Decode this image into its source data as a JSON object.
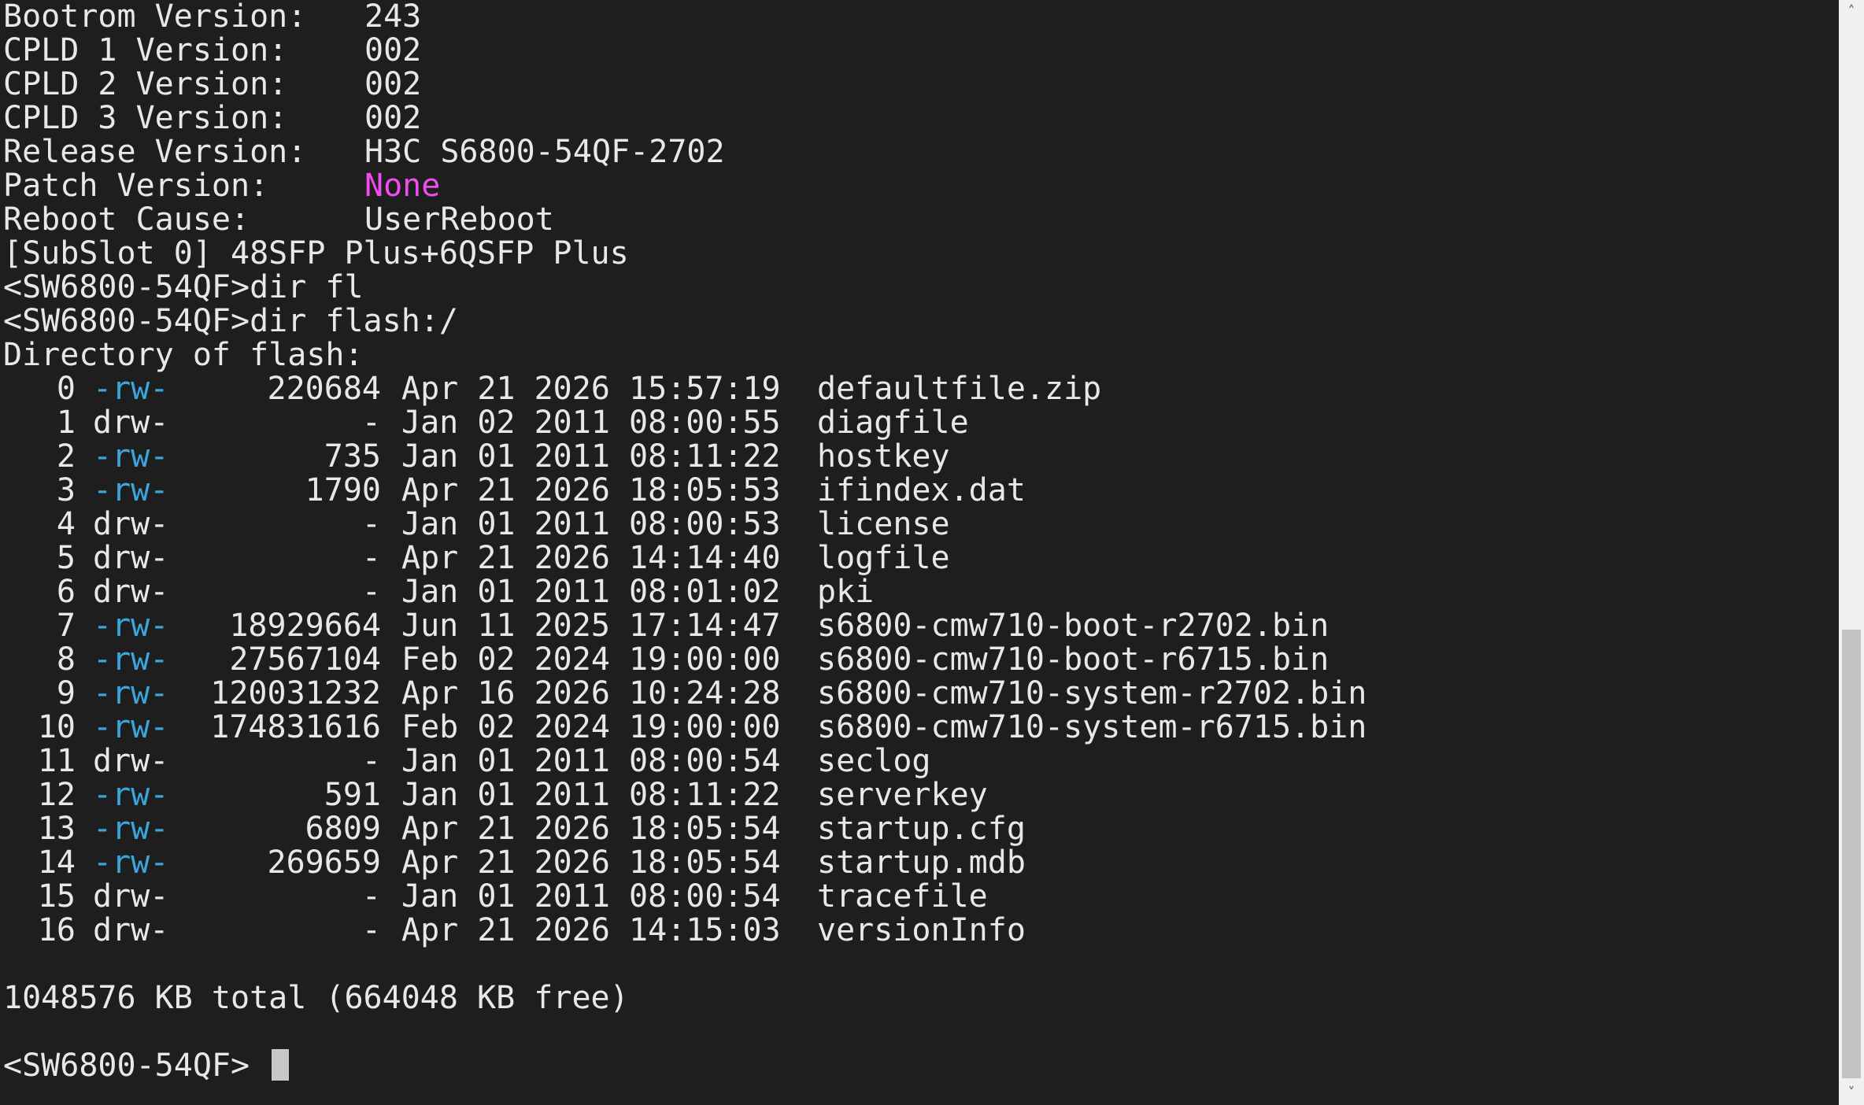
{
  "colors": {
    "background": "#1e1e1e",
    "text": "#e8e8e8",
    "permission_file": "#3aa6dc",
    "patch_none": "#f04cf0"
  },
  "version_info": [
    {
      "label": "Bootrom Version:",
      "value": "243"
    },
    {
      "label": "CPLD 1 Version:",
      "value": "002"
    },
    {
      "label": "CPLD 2 Version:",
      "value": "002"
    },
    {
      "label": "CPLD 3 Version:",
      "value": "002"
    },
    {
      "label": "Release Version:",
      "value": "H3C S6800-54QF-2702"
    },
    {
      "label": "Patch Version:",
      "value": "None"
    },
    {
      "label": "Reboot Cause:",
      "value": "UserReboot"
    }
  ],
  "subslot_line": "[SubSlot 0] 48SFP Plus+6QSFP Plus",
  "commands": [
    "<SW6800-54QF>dir fl",
    "<SW6800-54QF>dir flash:/"
  ],
  "directory_header": "Directory of flash:",
  "files": [
    {
      "index": "0",
      "perm": "-rw-",
      "size": "220684",
      "date": "Apr 21 2026 15:57:19",
      "name": "defaultfile.zip"
    },
    {
      "index": "1",
      "perm": "drw-",
      "size": "-",
      "date": "Jan 02 2011 08:00:55",
      "name": "diagfile"
    },
    {
      "index": "2",
      "perm": "-rw-",
      "size": "735",
      "date": "Jan 01 2011 08:11:22",
      "name": "hostkey"
    },
    {
      "index": "3",
      "perm": "-rw-",
      "size": "1790",
      "date": "Apr 21 2026 18:05:53",
      "name": "ifindex.dat"
    },
    {
      "index": "4",
      "perm": "drw-",
      "size": "-",
      "date": "Jan 01 2011 08:00:53",
      "name": "license"
    },
    {
      "index": "5",
      "perm": "drw-",
      "size": "-",
      "date": "Apr 21 2026 14:14:40",
      "name": "logfile"
    },
    {
      "index": "6",
      "perm": "drw-",
      "size": "-",
      "date": "Jan 01 2011 08:01:02",
      "name": "pki"
    },
    {
      "index": "7",
      "perm": "-rw-",
      "size": "18929664",
      "date": "Jun 11 2025 17:14:47",
      "name": "s6800-cmw710-boot-r2702.bin"
    },
    {
      "index": "8",
      "perm": "-rw-",
      "size": "27567104",
      "date": "Feb 02 2024 19:00:00",
      "name": "s6800-cmw710-boot-r6715.bin"
    },
    {
      "index": "9",
      "perm": "-rw-",
      "size": "120031232",
      "date": "Apr 16 2026 10:24:28",
      "name": "s6800-cmw710-system-r2702.bin"
    },
    {
      "index": "10",
      "perm": "-rw-",
      "size": "174831616",
      "date": "Feb 02 2024 19:00:00",
      "name": "s6800-cmw710-system-r6715.bin"
    },
    {
      "index": "11",
      "perm": "drw-",
      "size": "-",
      "date": "Jan 01 2011 08:00:54",
      "name": "seclog"
    },
    {
      "index": "12",
      "perm": "-rw-",
      "size": "591",
      "date": "Jan 01 2011 08:11:22",
      "name": "serverkey"
    },
    {
      "index": "13",
      "perm": "-rw-",
      "size": "6809",
      "date": "Apr 21 2026 18:05:54",
      "name": "startup.cfg"
    },
    {
      "index": "14",
      "perm": "-rw-",
      "size": "269659",
      "date": "Apr 21 2026 18:05:54",
      "name": "startup.mdb"
    },
    {
      "index": "15",
      "perm": "drw-",
      "size": "-",
      "date": "Jan 01 2011 08:00:54",
      "name": "tracefile"
    },
    {
      "index": "16",
      "perm": "drw-",
      "size": "-",
      "date": "Apr 21 2026 14:15:03",
      "name": "versionInfo"
    }
  ],
  "summary": "1048576 KB total (664048 KB free)",
  "prompt": "<SW6800-54QF> ",
  "scrollbar": {
    "up_icon": "chevron-up-icon",
    "down_icon": "chevron-down-icon",
    "up_glyph": "˄",
    "down_glyph": "˅"
  }
}
